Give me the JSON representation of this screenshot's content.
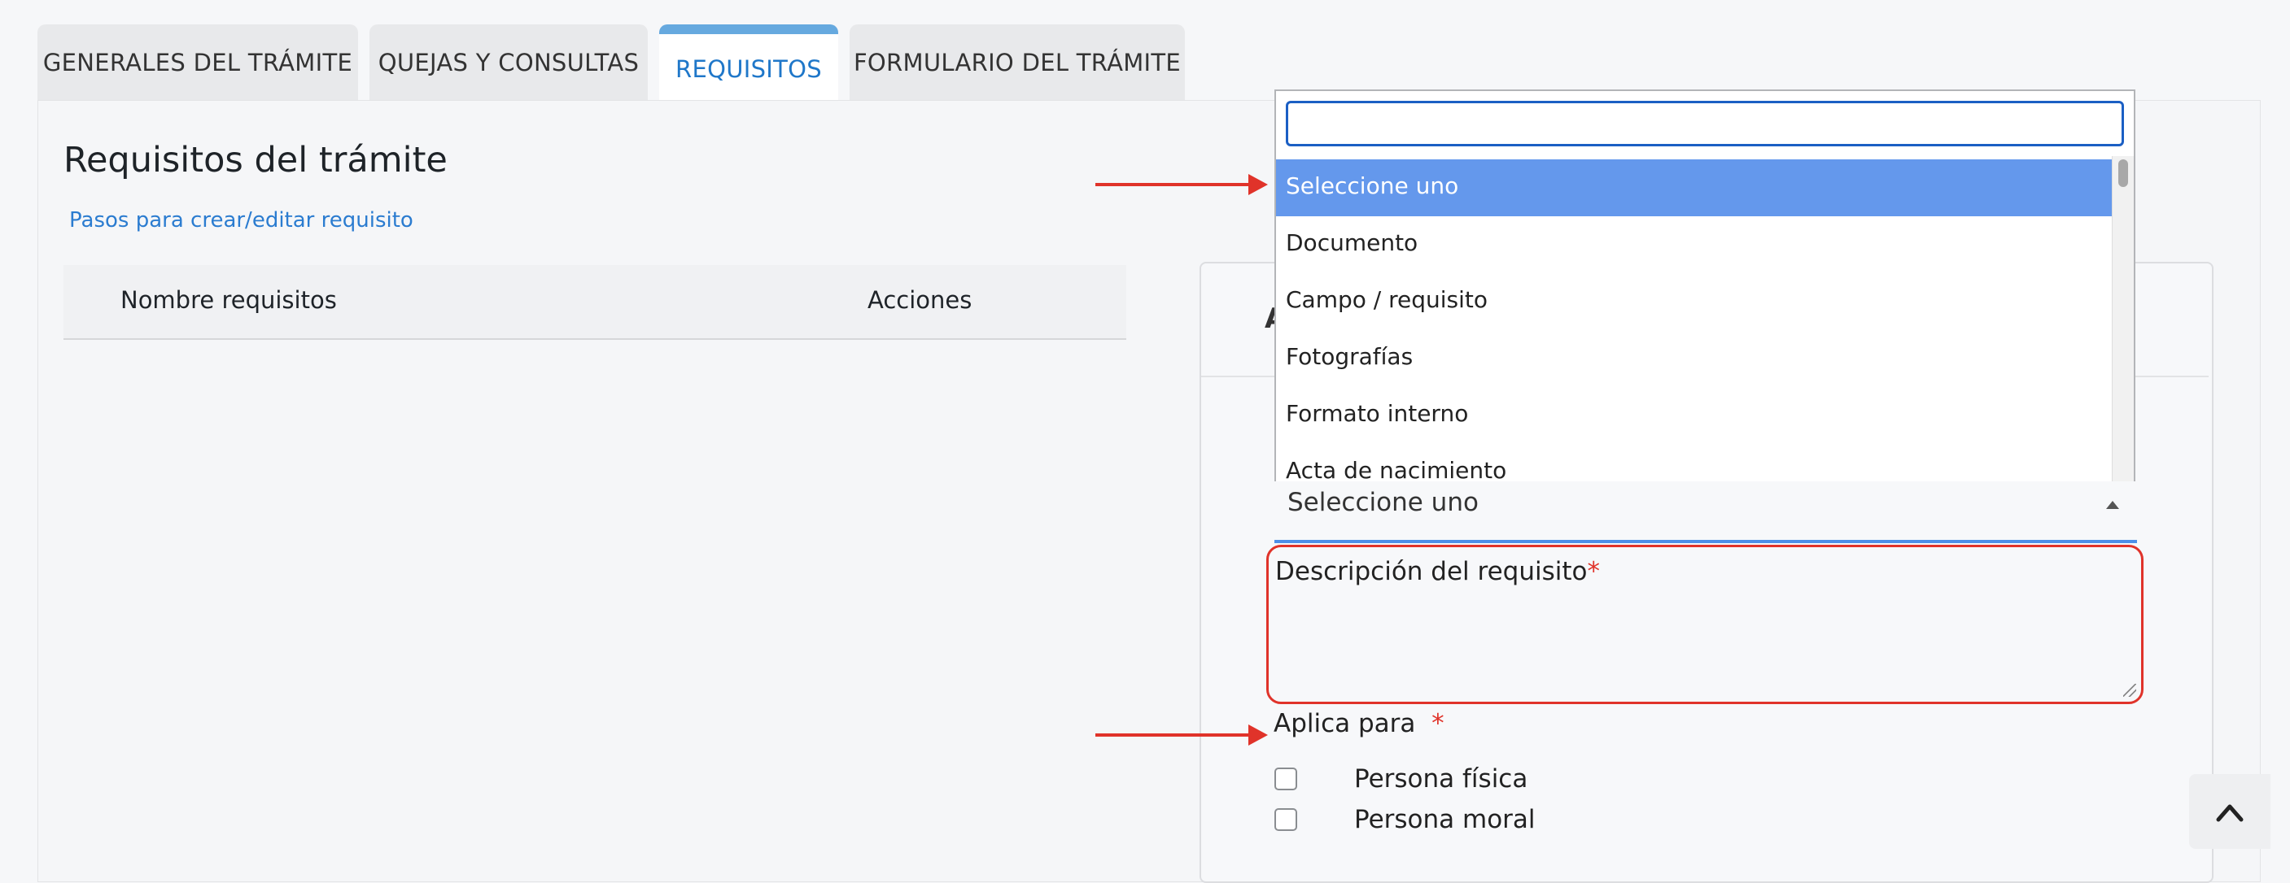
{
  "tabs": [
    {
      "label": "GENERALES DEL TRÁMITE"
    },
    {
      "label": "QUEJAS Y CONSULTAS"
    },
    {
      "label": "REQUISITOS"
    },
    {
      "label": "FORMULARIO DEL TRÁMITE"
    }
  ],
  "page": {
    "title": "Requisitos del trámite",
    "steps_link": "Pasos para crear/editar requisito"
  },
  "table": {
    "headers": [
      "Nombre requisitos",
      "Acciones"
    ]
  },
  "card": {
    "header_fragment": "A"
  },
  "requirement_type_select": {
    "search_value": "",
    "selected": "Seleccione uno",
    "options": [
      "Seleccione uno",
      "Documento",
      "Campo / requisito",
      "Fotografías",
      "Formato interno",
      "Acta de nacimiento"
    ]
  },
  "description_field": {
    "label": "Descripción del requisito",
    "required_mark": "*"
  },
  "aplica_para": {
    "label": "Aplica para",
    "required_mark": "*",
    "options": [
      {
        "label": "Persona física",
        "checked": false
      },
      {
        "label": "Persona moral",
        "checked": false
      }
    ]
  },
  "colors": {
    "accent": "#1f77c9",
    "selected_option": "#6498ec",
    "annotation_arrow": "#e0332a",
    "error_border": "#e0332a"
  }
}
